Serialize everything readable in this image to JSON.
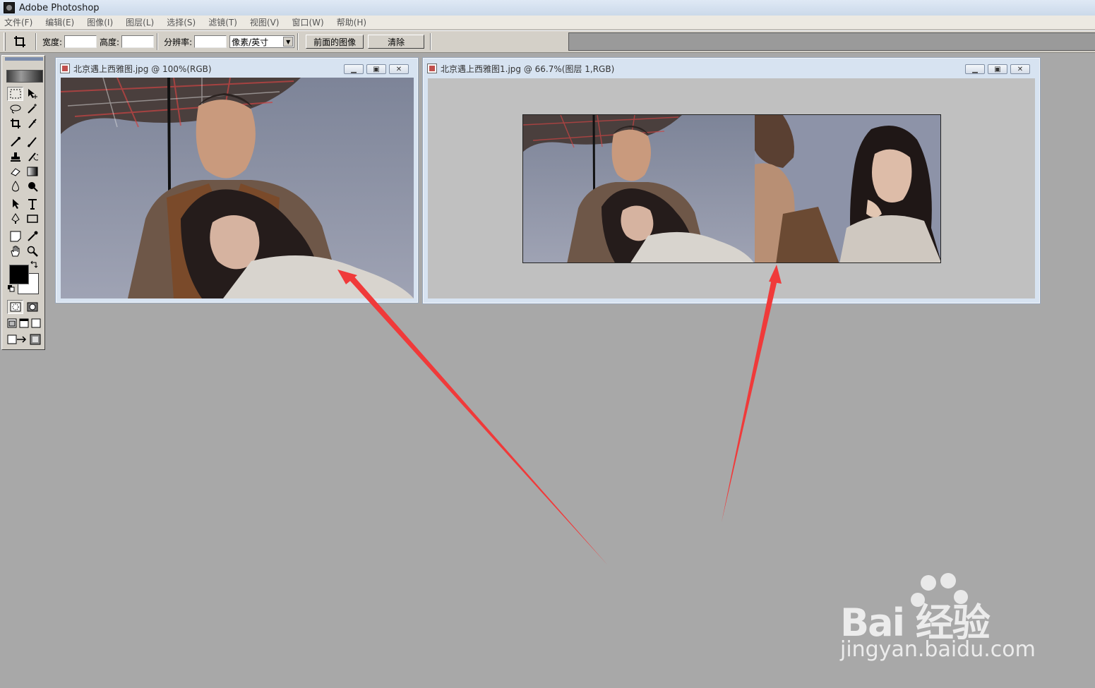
{
  "app": {
    "title": "Adobe Photoshop"
  },
  "menu": [
    "文件(F)",
    "编辑(E)",
    "图像(I)",
    "图层(L)",
    "选择(S)",
    "滤镜(T)",
    "视图(V)",
    "窗口(W)",
    "帮助(H)"
  ],
  "options": {
    "width_label": "宽度:",
    "width_value": "",
    "height_label": "高度:",
    "height_value": "",
    "resolution_label": "分辨率:",
    "resolution_value": "",
    "unit_selected": "像素/英寸",
    "front_image_button": "前面的图像",
    "clear_button": "清除"
  },
  "icons": {
    "crop": "crop-icon",
    "marquee": "rect-marquee-icon",
    "move": "move-icon",
    "lasso": "lasso-icon",
    "magic_wand": "magic-wand-icon",
    "airbrush": "airbrush-icon",
    "brush": "brush-icon",
    "stamp": "clone-stamp-icon",
    "history_brush": "history-brush-icon",
    "eraser": "eraser-icon",
    "gradient": "gradient-icon",
    "blur": "blur-icon",
    "dodge": "dodge-icon",
    "path_select": "path-select-icon",
    "type": "type-icon",
    "pen": "pen-icon",
    "shape": "rectangle-shape-icon",
    "notes": "notes-icon",
    "eyedropper": "eyedropper-icon",
    "hand": "hand-icon",
    "zoom": "zoom-icon"
  },
  "documents": [
    {
      "title": "北京遇上西雅图.jpg @ 100%(RGB)"
    },
    {
      "title": "北京遇上西雅图1.jpg @ 66.7%(图层 1,RGB)"
    }
  ],
  "watermark": {
    "brand": "Bai 经验",
    "url": "jingyan.baidu.com"
  },
  "colors": {
    "workspace": "#a8a8a8",
    "annotation_arrow": "#f03a3a",
    "foreground": "#000000",
    "background": "#ffffff"
  }
}
